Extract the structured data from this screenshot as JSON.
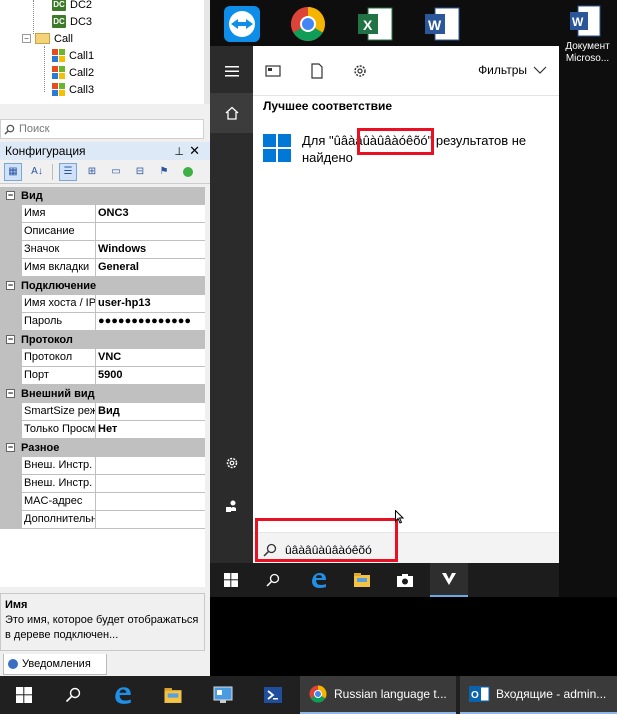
{
  "tree": {
    "items": [
      {
        "label": "DC2",
        "kind": "dc"
      },
      {
        "label": "DC3",
        "kind": "dc"
      },
      {
        "label": "Call",
        "kind": "folder"
      },
      {
        "label": "Call1",
        "kind": "call"
      },
      {
        "label": "Call2",
        "kind": "call"
      },
      {
        "label": "Call3",
        "kind": "call"
      }
    ]
  },
  "search": {
    "placeholder": "Поиск"
  },
  "config": {
    "title": "Конфигурация",
    "pin_icon": "pin-icon",
    "close_icon": "close-icon",
    "categories": [
      {
        "name": "Вид",
        "rows": [
          {
            "name": "Имя",
            "value": "ONC3"
          },
          {
            "name": "Описание",
            "value": ""
          },
          {
            "name": "Значок",
            "value": "Windows"
          },
          {
            "name": "Имя вкладки",
            "value": "General"
          }
        ]
      },
      {
        "name": "Подключение",
        "rows": [
          {
            "name": "Имя хоста / IP",
            "value": "user-hp13"
          },
          {
            "name": "Пароль",
            "value": "●●●●●●●●●●●●●●"
          }
        ]
      },
      {
        "name": "Протокол",
        "rows": [
          {
            "name": "Протокол",
            "value": "VNC"
          },
          {
            "name": "Порт",
            "value": "5900"
          }
        ]
      },
      {
        "name": "Внешний вид",
        "rows": [
          {
            "name": "SmartSize режим",
            "value": "Вид"
          },
          {
            "name": "Только Просмотр",
            "value": "Нет"
          }
        ]
      },
      {
        "name": "Разное",
        "rows": [
          {
            "name": "Внеш. Инстр.",
            "value": ""
          },
          {
            "name": "Внеш. Инстр.",
            "value": ""
          },
          {
            "name": "MAC-адрес",
            "value": ""
          },
          {
            "name": "Дополнительно",
            "value": ""
          }
        ]
      }
    ]
  },
  "description": {
    "title": "Имя",
    "text": "Это имя, которое будет отображаться в дереве подключен..."
  },
  "notifications_tab": {
    "label": "Уведомления"
  },
  "desktop": {
    "icons": [
      {
        "name": "teamviewer-icon"
      },
      {
        "name": "chrome-icon"
      },
      {
        "name": "excel-icon"
      },
      {
        "name": "word-icon"
      },
      {
        "name": "word-document-icon",
        "label": "Документ Microso..."
      }
    ]
  },
  "start_menu": {
    "filters_label": "Фильтры",
    "best_match_title": "Лучшее соответствие",
    "result_prefix": "Для ",
    "result_query": "\"ûâàâûàûâàóêõó\"",
    "result_suffix": " результатов не найдено",
    "search_value": "ûâàâûàûâàóêõó"
  },
  "taskbar": {
    "chrome_label": "Russian language t...",
    "outlook_label": "Входящие - admin..."
  },
  "colors": {
    "accent": "#0078d7",
    "highlight": "#e81123",
    "taskbar": "#202020"
  }
}
